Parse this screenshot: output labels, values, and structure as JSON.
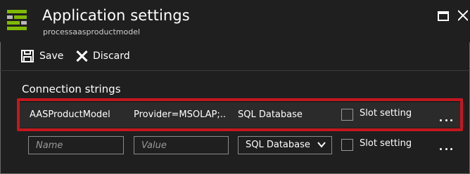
{
  "header": {
    "title": "Application settings",
    "subtitle": "processaasproductmodel"
  },
  "toolbar": {
    "save_label": "Save",
    "discard_label": "Discard"
  },
  "section": {
    "title": "Connection strings"
  },
  "connection_strings": [
    {
      "name": "AASProductModel",
      "value": "Provider=MSOLAP;...",
      "type": "SQL Database",
      "slot_setting_label": "Slot setting",
      "slot_setting_checked": false
    }
  ],
  "new_row": {
    "name_placeholder": "Name",
    "value_placeholder": "Value",
    "type_selected": "SQL Database",
    "slot_setting_label": "Slot setting"
  },
  "colors": {
    "background": "#1f1f1f",
    "highlight_border": "#c4171f",
    "icon_green": "#7fba00"
  },
  "icons": {
    "app": "app-settings-icon",
    "save": "save-icon",
    "discard": "close-icon",
    "maximize": "maximize-icon",
    "close": "close-icon",
    "more": "ellipsis-icon",
    "dropdown": "chevron-down-icon"
  }
}
